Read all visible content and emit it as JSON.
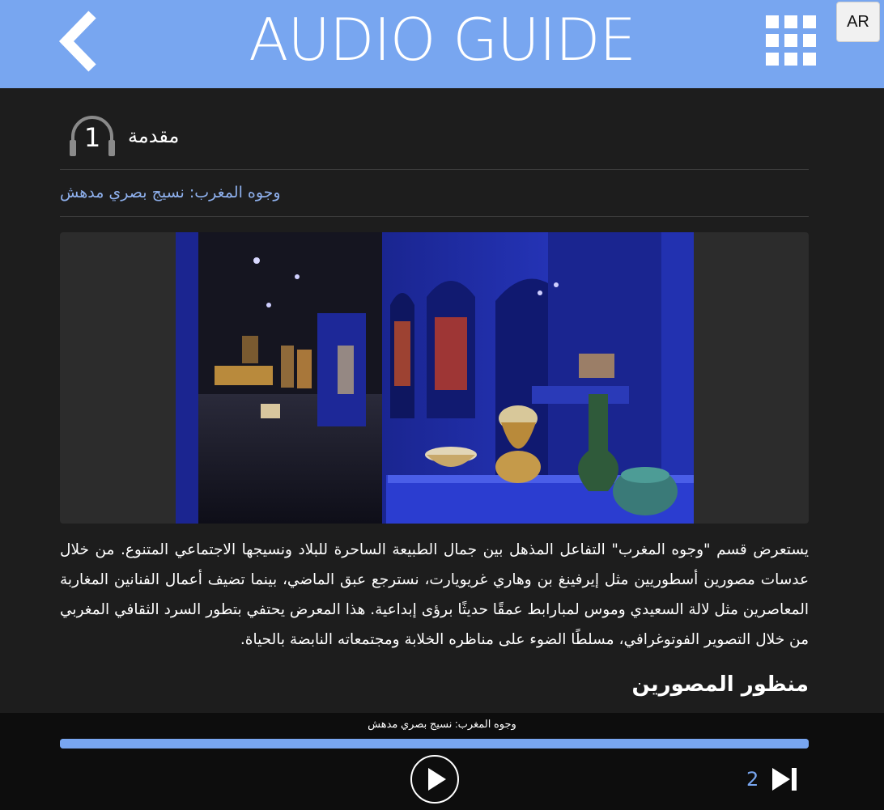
{
  "header": {
    "title": "AUDIO GUIDE",
    "lang_label": "AR",
    "back_icon": "chevron-left-icon",
    "menu_icon": "grid-icon",
    "color": "#78a6f0"
  },
  "intro": {
    "number": "1",
    "label": "مقدمة",
    "icon": "headphones-icon"
  },
  "subtitle": "وجوه المغرب: نسيج بصري مدهش",
  "body": "يستعرض قسم \"وجوه المغرب\" التفاعل المذهل بين جمال الطبيعة الساحرة للبلاد ونسيجها الاجتماعي المتنوع. من خلال عدسات مصورين أسطوريين مثل إيرفينغ بن وهاري غريويارت، نسترجع عبق الماضي، بينما تضيف أعمال الفنانين المغاربة المعاصرين مثل لالة السعيدي وموس لمبارابط عمقًا حديثًا برؤى إبداعية. هذا المعرض يحتفي بتطور السرد الثقافي المغربي من خلال التصوير الفوتوغرافي، مسلطًا الضوء على مناظره الخلابة ومجتمعاته النابضة بالحياة.",
  "section_heading": "منظور المصورين",
  "player": {
    "track_title": "وجوه المغرب: نسيج بصري مدهش",
    "progress": 1.0,
    "next_number": "2",
    "play_icon": "play-icon",
    "next_icon": "skip-next-icon",
    "progress_color": "#78a6f0"
  }
}
